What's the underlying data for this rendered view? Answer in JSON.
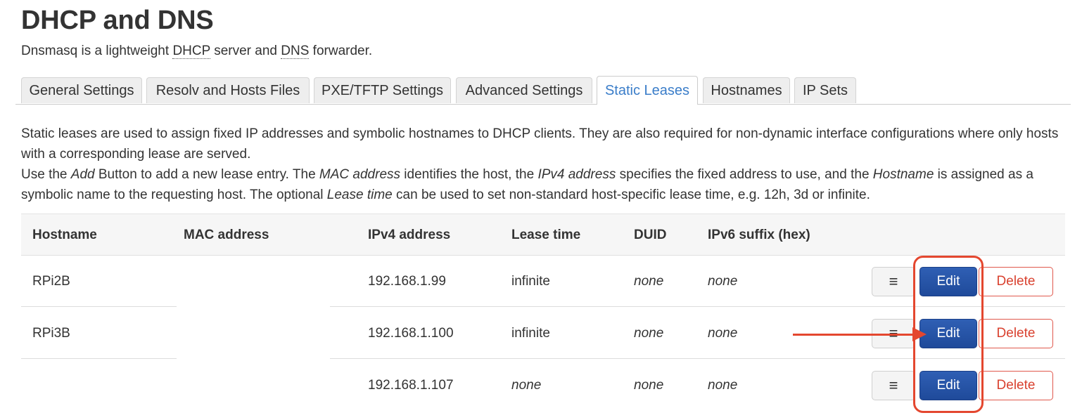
{
  "page": {
    "title": "DHCP and DNS",
    "subtitle_prefix": "Dnsmasq is a lightweight ",
    "subtitle_dhcp": "DHCP",
    "subtitle_mid": " server and ",
    "subtitle_dns": "DNS",
    "subtitle_suffix": " forwarder."
  },
  "tabs": [
    {
      "label": "General Settings"
    },
    {
      "label": "Resolv and Hosts Files"
    },
    {
      "label": "PXE/TFTP Settings"
    },
    {
      "label": "Advanced Settings"
    },
    {
      "label": "Static Leases",
      "active": true
    },
    {
      "label": "Hostnames"
    },
    {
      "label": "IP Sets"
    }
  ],
  "description": {
    "p1": "Static leases are used to assign fixed IP addresses and symbolic hostnames to DHCP clients. They are also required for non-dynamic interface configurations where only hosts with a corresponding lease are served.",
    "p2_a": "Use the ",
    "p2_add": "Add",
    "p2_b": " Button to add a new lease entry. The ",
    "p2_mac": "MAC address",
    "p2_c": " identifies the host, the ",
    "p2_ipv4": "IPv4 address",
    "p2_d": " specifies the fixed address to use, and the ",
    "p2_hostname": "Hostname",
    "p2_e": " is assigned as a symbolic name to the requesting host. The optional ",
    "p2_lease": "Lease time",
    "p2_f": " can be used to set non-standard host-specific lease time, e.g. 12h, 3d or infinite."
  },
  "table": {
    "headers": {
      "hostname": "Hostname",
      "mac": "MAC address",
      "ipv4": "IPv4 address",
      "lease": "Lease time",
      "duid": "DUID",
      "ipv6": "IPv6 suffix (hex)"
    },
    "rows": [
      {
        "hostname": "RPi2B",
        "mac": "",
        "ipv4": "192.168.1.99",
        "lease": "infinite",
        "duid": "none",
        "ipv6": "none"
      },
      {
        "hostname": "RPi3B",
        "mac": "",
        "ipv4": "192.168.1.100",
        "lease": "infinite",
        "duid": "none",
        "ipv6": "none"
      },
      {
        "hostname": "",
        "mac": "",
        "ipv4": "192.168.1.107",
        "lease": "none",
        "duid": "none",
        "ipv6": "none"
      }
    ],
    "buttons": {
      "drag": "≡",
      "edit": "Edit",
      "delete": "Delete"
    }
  },
  "colors": {
    "accent": "#3a7dc9",
    "edit_button": "#2a56a8",
    "delete_border": "#e0584c",
    "annotation": "#e4472f"
  }
}
